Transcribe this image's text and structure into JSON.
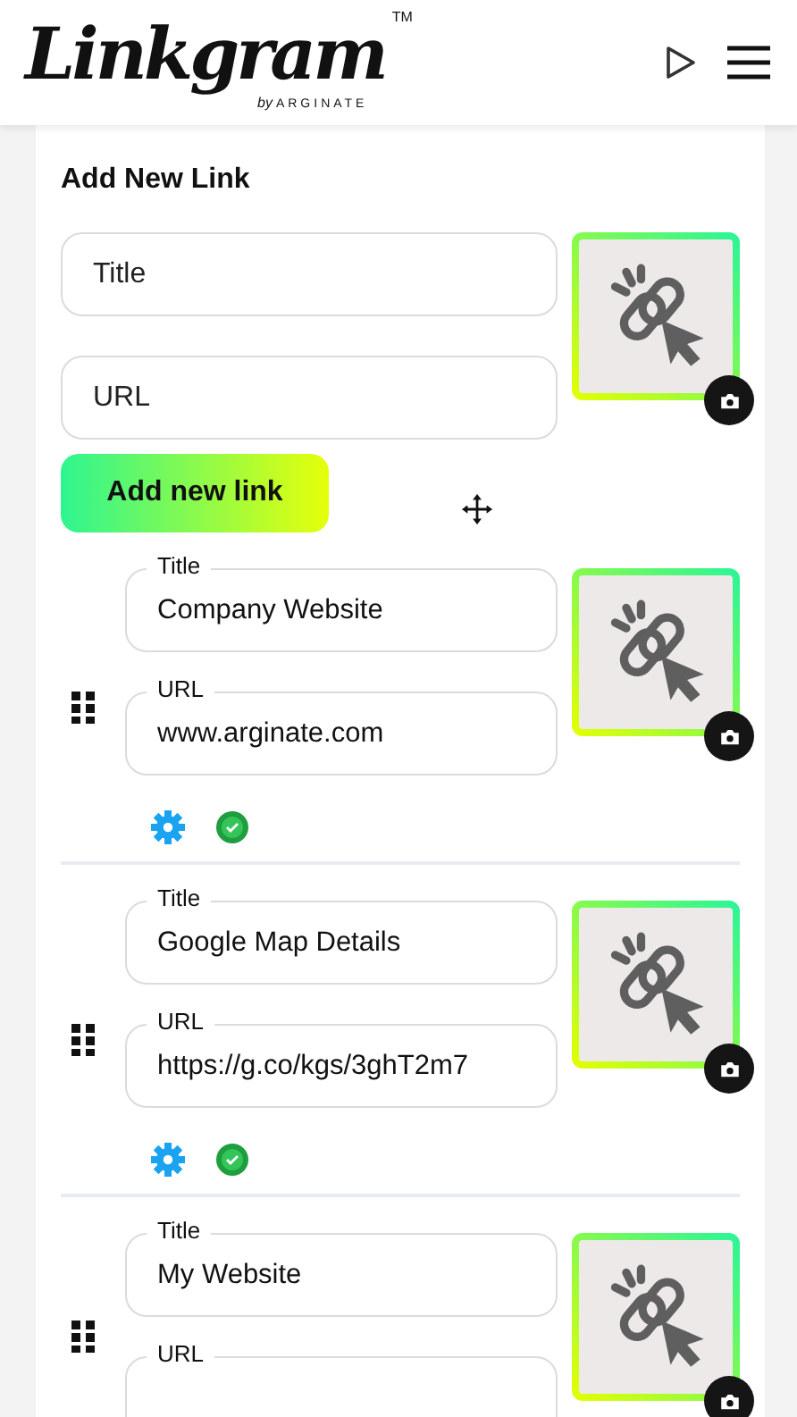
{
  "header": {
    "logo": {
      "name": "Linkgram",
      "trademark": "TM",
      "by": "by",
      "company": "ARGINATE"
    }
  },
  "add_form": {
    "heading": "Add New Link",
    "title_field": {
      "placeholder": "Title"
    },
    "url_field": {
      "placeholder": "URL"
    },
    "button": "Add new link"
  },
  "links": [
    {
      "title_label": "Title",
      "title": "Company Website",
      "url_label": "URL",
      "url": "www.arginate.com",
      "active": true
    },
    {
      "title_label": "Title",
      "title": "Google Map Details",
      "url_label": "URL",
      "url": "https://g.co/kgs/3ghT2m7",
      "active": true
    },
    {
      "title_label": "Title",
      "title": "My Website",
      "url_label": "URL"
    }
  ]
}
